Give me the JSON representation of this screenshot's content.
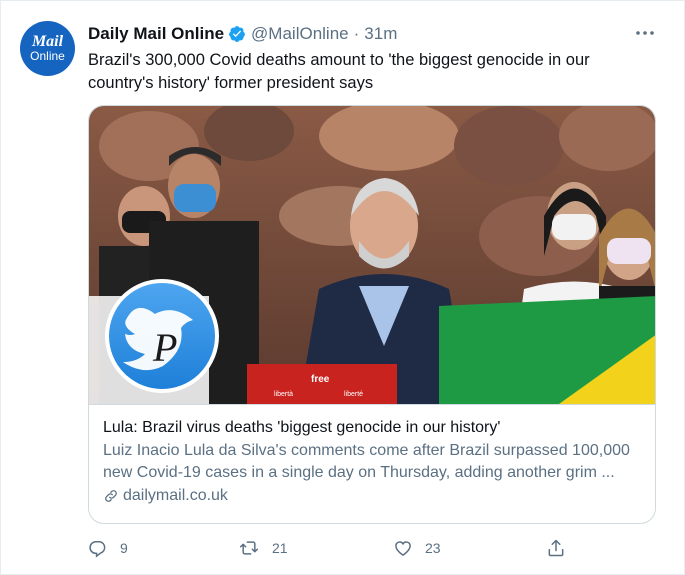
{
  "author": {
    "avatar_line1": "Mail",
    "avatar_line2": "Online",
    "name": "Daily Mail Online",
    "handle": "@MailOnline",
    "separator": "·",
    "time": "31m"
  },
  "tweet": {
    "text": "Brazil's 300,000 Covid deaths amount to 'the biggest genocide in our country's history' former president says"
  },
  "card": {
    "image_banner_words": [
      "free",
      "libertà",
      "liberté"
    ],
    "title": "Lula: Brazil virus deaths 'biggest genocide in our history'",
    "description": "Luiz Inacio Lula da Silva's comments come after Brazil surpassed 100,000 new Covid-19 cases in a single day on Thursday, adding another grim ...",
    "domain": "dailymail.co.uk"
  },
  "actions": {
    "replies": "9",
    "retweets": "21",
    "likes": "23"
  },
  "colors": {
    "text": "#0f1419",
    "secondary": "#5b7083",
    "verified": "#1da1f2",
    "border": "#cfd9de"
  },
  "icons": [
    "verified-badge-icon",
    "more-options-icon",
    "link-icon",
    "reply-icon",
    "retweet-icon",
    "like-icon",
    "share-icon",
    "watermark-bird-icon"
  ]
}
